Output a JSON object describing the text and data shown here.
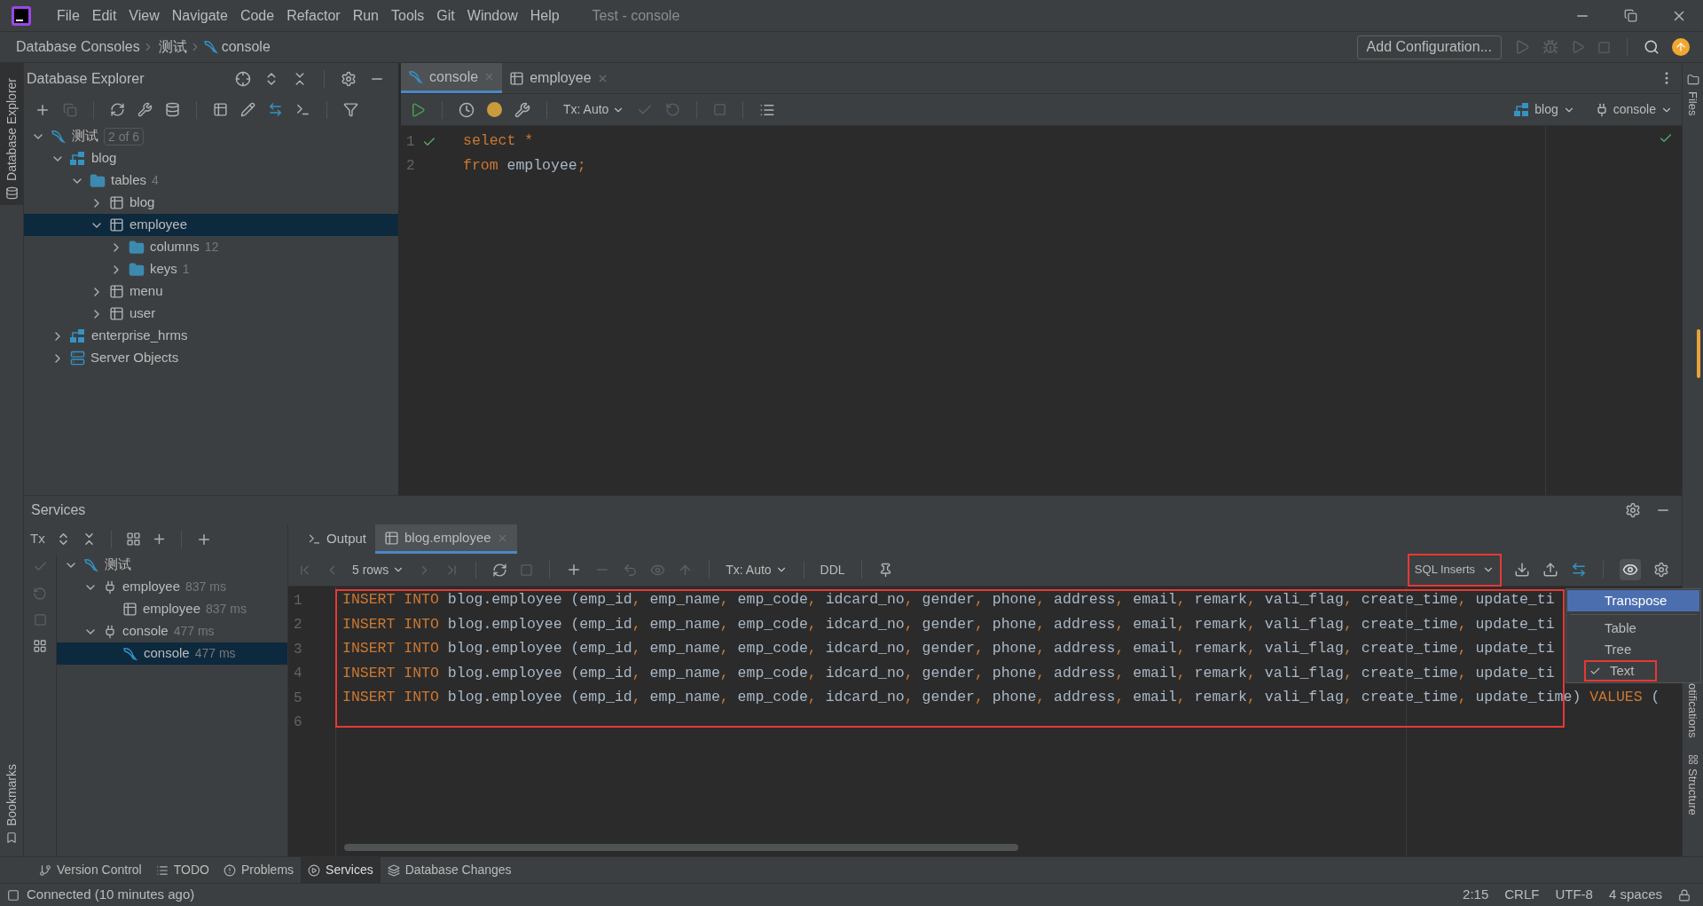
{
  "title_bar": {
    "menus": [
      "File",
      "Edit",
      "View",
      "Navigate",
      "Code",
      "Refactor",
      "Run",
      "Tools",
      "Git",
      "Window",
      "Help"
    ],
    "title": "Test - console"
  },
  "nav_bar": {
    "breadcrumb": [
      "Database Consoles",
      "测试",
      "console"
    ],
    "config_button": "Add Configuration..."
  },
  "left_strip": {
    "tool_window": "Database Explorer",
    "bookmarks": "Bookmarks"
  },
  "right_strip": {
    "files": "Files",
    "notifications": "otifications",
    "structure": "Structure"
  },
  "db_explorer": {
    "title": "Database Explorer",
    "tree": [
      {
        "label": "测试",
        "kind": "connection",
        "badge": "2 of 6",
        "expanded": true,
        "selected": false,
        "children": [
          {
            "label": "blog",
            "kind": "schema",
            "expanded": true,
            "selected": false,
            "children": [
              {
                "label": "tables",
                "kind": "folder",
                "count": "4",
                "expanded": true,
                "selected": false,
                "children": [
                  {
                    "label": "blog",
                    "kind": "table",
                    "expanded": false,
                    "selected": false
                  },
                  {
                    "label": "employee",
                    "kind": "table",
                    "expanded": true,
                    "selected": true,
                    "children": [
                      {
                        "label": "columns",
                        "kind": "folder",
                        "count": "12",
                        "expanded": false,
                        "selected": false
                      },
                      {
                        "label": "keys",
                        "kind": "folder",
                        "count": "1",
                        "expanded": false,
                        "selected": false
                      }
                    ]
                  },
                  {
                    "label": "menu",
                    "kind": "table",
                    "expanded": false,
                    "selected": false
                  },
                  {
                    "label": "user",
                    "kind": "table",
                    "expanded": false,
                    "selected": false
                  }
                ]
              }
            ]
          },
          {
            "label": "enterprise_hrms",
            "kind": "schema",
            "expanded": false,
            "selected": false
          },
          {
            "label": "Server Objects",
            "kind": "server",
            "expanded": false,
            "selected": false
          }
        ]
      }
    ]
  },
  "editor": {
    "tabs": [
      {
        "label": "console",
        "kind": "console",
        "selected": true
      },
      {
        "label": "employee",
        "kind": "table",
        "selected": false
      }
    ],
    "tx_mode": "Tx: Auto",
    "schema": "blog",
    "session": "console",
    "lines": [
      {
        "number": "1",
        "segments": [
          {
            "kind": "keyword",
            "text": "select *"
          }
        ]
      },
      {
        "number": "2",
        "segments": [
          {
            "kind": "keyword",
            "text": "from"
          },
          {
            "kind": "plain",
            "text": " employee"
          },
          {
            "kind": "keyword",
            "text": ";"
          }
        ]
      }
    ]
  },
  "services": {
    "title": "Services",
    "tx": "Tx",
    "tree": [
      {
        "label": "测试",
        "kind": "console",
        "expanded": true,
        "selected": false,
        "children": [
          {
            "label": "employee",
            "kind": "session",
            "count": "837 ms",
            "expanded": true,
            "selected": false,
            "children": [
              {
                "label": "employee",
                "kind": "table",
                "count": "837 ms",
                "selected": false
              }
            ]
          },
          {
            "label": "console",
            "kind": "session",
            "count": "477 ms",
            "expanded": true,
            "selected": false,
            "children": [
              {
                "label": "console",
                "kind": "console",
                "count": "477 ms",
                "selected": true
              }
            ]
          }
        ]
      }
    ],
    "tabs": [
      {
        "label": "Output",
        "kind": "output",
        "selected": false
      },
      {
        "label": "blog.employee",
        "kind": "table",
        "selected": true
      }
    ],
    "rows": "5 rows",
    "tx_mode": "Tx: Auto",
    "ddl": "DDL",
    "format": "SQL Inserts",
    "lines": [
      {
        "number": "1",
        "segments": [
          {
            "kind": "keyword",
            "text": "INSERT INTO"
          },
          {
            "kind": "plain",
            "text": " blog.employee (emp_id, emp_name, emp_code, idcard_no, gender, phone, address, email, remark, vali_flag, create_time, update_ti"
          }
        ]
      },
      {
        "number": "2",
        "segments": [
          {
            "kind": "keyword",
            "text": "INSERT INTO"
          },
          {
            "kind": "plain",
            "text": " blog.employee (emp_id, emp_name, emp_code, idcard_no, gender, phone, address, email, remark, vali_flag, create_time, update_ti"
          }
        ]
      },
      {
        "number": "3",
        "segments": [
          {
            "kind": "keyword",
            "text": "INSERT INTO"
          },
          {
            "kind": "plain",
            "text": " blog.employee (emp_id, emp_name, emp_code, idcard_no, gender, phone, address, email, remark, vali_flag, create_time, update_ti"
          }
        ]
      },
      {
        "number": "4",
        "segments": [
          {
            "kind": "keyword",
            "text": "INSERT INTO"
          },
          {
            "kind": "plain",
            "text": " blog.employee (emp_id, emp_name, emp_code, idcard_no, gender, phone, address, email, remark, vali_flag, create_time, update_ti"
          }
        ]
      },
      {
        "number": "5",
        "segments": [
          {
            "kind": "keyword",
            "text": "INSERT INTO"
          },
          {
            "kind": "plain",
            "text": " blog.employee (emp_id, emp_name, emp_code, idcard_no, gender, phone, address, email, remark, vali_flag, create_time, update_time)"
          },
          {
            "kind": "keyword",
            "text": " VALUES"
          },
          {
            "kind": "plain",
            "text": " ("
          }
        ]
      },
      {
        "number": "6"
      }
    ],
    "view_menu": [
      {
        "label": "Transpose",
        "selected": true,
        "checked": false
      },
      {
        "label": "Table",
        "selected": false,
        "checked": false
      },
      {
        "label": "Tree",
        "selected": false,
        "checked": false
      },
      {
        "label": "Text",
        "selected": false,
        "checked": true
      }
    ]
  },
  "tool_tabs": [
    {
      "label": "Version Control",
      "kind": "vcs",
      "selected": false
    },
    {
      "label": "TODO",
      "kind": "todo",
      "selected": false
    },
    {
      "label": "Problems",
      "kind": "problems",
      "selected": false
    },
    {
      "label": "Services",
      "kind": "services",
      "selected": true
    },
    {
      "label": "Database Changes",
      "kind": "changes",
      "selected": false
    }
  ],
  "status_bar": {
    "message": "Connected (10 minutes ago)",
    "position": "2:15",
    "line_ending": "CRLF",
    "encoding": "UTF-8",
    "indent": "4 spaces"
  }
}
